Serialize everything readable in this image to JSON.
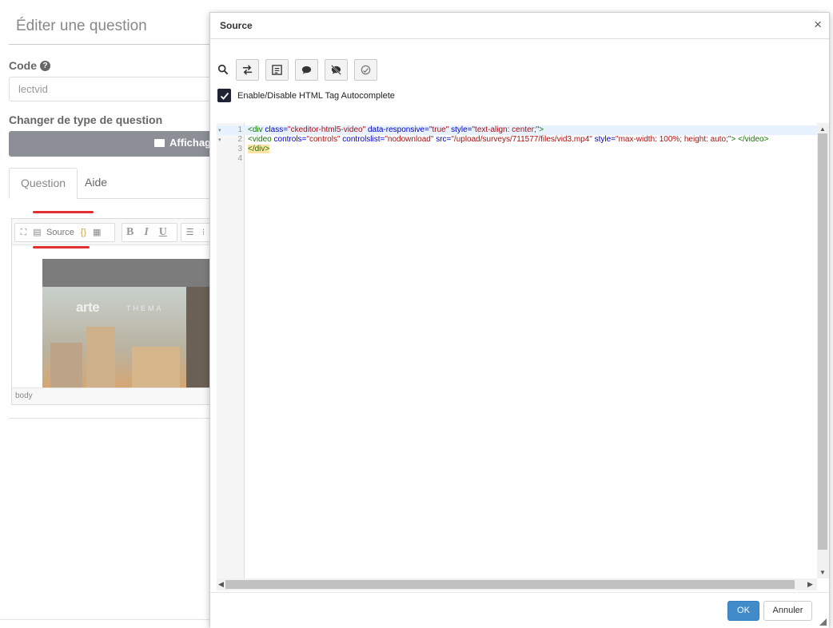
{
  "background_page": {
    "title": "Éditer une question",
    "code_label": "Code",
    "code_value": "lectvid",
    "type_label": "Changer de type de question",
    "type_button_label": "Affichag",
    "tabs": [
      {
        "label": "Question",
        "active": true
      },
      {
        "label": "Aide",
        "active": false
      }
    ],
    "editor": {
      "toolbar": {
        "source_label": "Source",
        "bold": "B",
        "italic": "I",
        "underline": "U"
      },
      "video_brand": "arte",
      "video_subbrand": "THEMA",
      "status_path": "body"
    }
  },
  "dialog": {
    "title": "Source",
    "close_symbol": "×",
    "autocomplete_label": "Enable/Disable HTML Tag Autocomplete",
    "autocomplete_checked": true,
    "code_lines": [
      {
        "num": "1",
        "fold": true
      },
      {
        "num": "2",
        "fold": true
      },
      {
        "num": "3",
        "fold": false
      },
      {
        "num": "4",
        "fold": false
      }
    ],
    "code": {
      "line1": {
        "tag_open": "<div",
        "attr1": "class=",
        "val1": "\"ckeditor-html5-video\"",
        "attr2": "data-responsive=",
        "val2": "\"true\"",
        "attr3": "style=",
        "val3": "\"text-align: center;\"",
        "tag_close": ">"
      },
      "line2": {
        "tag_open": "<video",
        "attr1": "controls=",
        "val1": "\"controls\"",
        "attr2": "controlslist=",
        "val2": "\"nodownload\"",
        "attr3": "src=",
        "val3": "\"/upload/surveys/711577/files/vid3.mp4\"",
        "attr4": "style=",
        "val4": "\"max-width: 100%; height: auto;\"",
        "tag_close": ">",
        "end_tag": "</video>"
      },
      "line3": {
        "end_tag": "</div>"
      }
    },
    "buttons": {
      "ok": "OK",
      "cancel": "Annuler"
    }
  },
  "colors": {
    "accent": "#428bca",
    "annotation_red": "#e23030",
    "checkbox": "#1d2332"
  }
}
